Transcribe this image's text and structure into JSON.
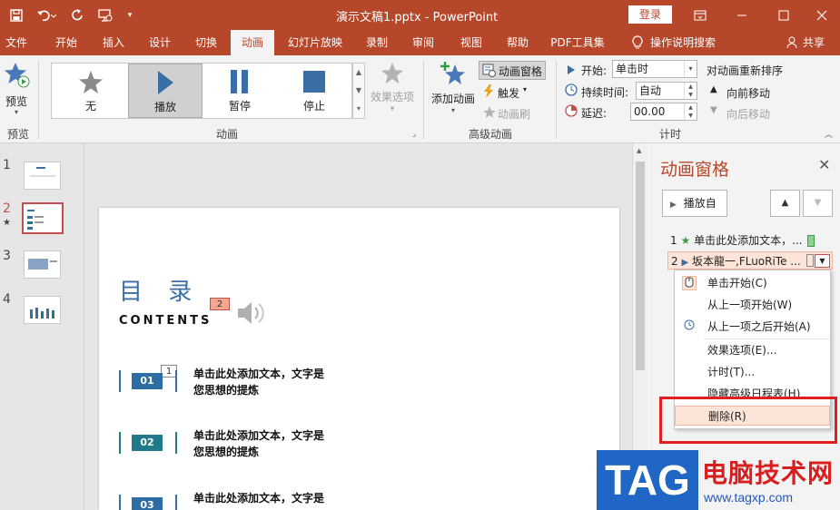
{
  "window": {
    "title": "演示文稿1.pptx  -  PowerPoint",
    "login_label": "登录"
  },
  "tabs": [
    {
      "label": "文件"
    },
    {
      "label": "开始"
    },
    {
      "label": "插入"
    },
    {
      "label": "设计"
    },
    {
      "label": "切换"
    },
    {
      "label": "动画"
    },
    {
      "label": "幻灯片放映"
    },
    {
      "label": "录制"
    },
    {
      "label": "审阅"
    },
    {
      "label": "视图"
    },
    {
      "label": "帮助"
    },
    {
      "label": "PDF工具集"
    },
    {
      "label": "操作说明搜索"
    },
    {
      "label": "共享"
    }
  ],
  "ribbon": {
    "preview_label": "预览",
    "preview_group": "预览",
    "animation_group": "动画",
    "gallery": [
      {
        "label": "无"
      },
      {
        "label": "播放"
      },
      {
        "label": "暂停"
      },
      {
        "label": "停止"
      }
    ],
    "effect_options": "效果选项",
    "add_animation": "添加动画",
    "animation_pane": "动画窗格",
    "trigger": "触发",
    "animation_painter": "动画刷",
    "advanced_group": "高级动画",
    "start_label": "开始:",
    "start_value": "单击时",
    "duration_label": "持续时间:",
    "duration_value": "自动",
    "delay_label": "延迟:",
    "delay_value": "00.00",
    "reorder_label": "对动画重新排序",
    "move_earlier": "向前移动",
    "move_later": "向后移动",
    "timing_group": "计时"
  },
  "thumbnails": [
    {
      "num": "1"
    },
    {
      "num": "2"
    },
    {
      "num": "3"
    },
    {
      "num": "4"
    }
  ],
  "slide": {
    "title": "目 录",
    "subtitle": "CONTENTS",
    "audio_tag": "2",
    "item1_tag": "1",
    "items": [
      {
        "num": "01",
        "line1": "单击此处添加文本，文字是",
        "line2": "您思想的提炼",
        "color": "#2e6da4"
      },
      {
        "num": "02",
        "line1": "单击此处添加文本，文字是",
        "line2": "您思想的提炼",
        "color": "#217a8a"
      },
      {
        "num": "03",
        "line1": "单击此处添加文本，文字是",
        "line2": "",
        "color": "#2e6da4"
      }
    ]
  },
  "animation_pane": {
    "title": "动画窗格",
    "play_label": "播放自",
    "rows": [
      {
        "num": "1",
        "text": "单击此处添加文本，..."
      },
      {
        "num": "2",
        "text": "坂本龍一,FLuoRiTe ..."
      }
    ]
  },
  "context_menu": {
    "items": [
      {
        "label": "单击开始(C)"
      },
      {
        "label": "从上一项开始(W)"
      },
      {
        "label": "从上一项之后开始(A)"
      },
      {
        "label": "效果选项(E)..."
      },
      {
        "label": "计时(T)..."
      },
      {
        "label": "隐藏高级日程表(H)"
      },
      {
        "label": "删除(R)"
      }
    ]
  },
  "watermark": {
    "tag": "TAG",
    "site_name": "电脑技术网",
    "url": "www.tagxp.com"
  },
  "colors": {
    "accent": "#b7472a",
    "highlight": "#fde4d8",
    "annotation_red": "#e02020"
  }
}
